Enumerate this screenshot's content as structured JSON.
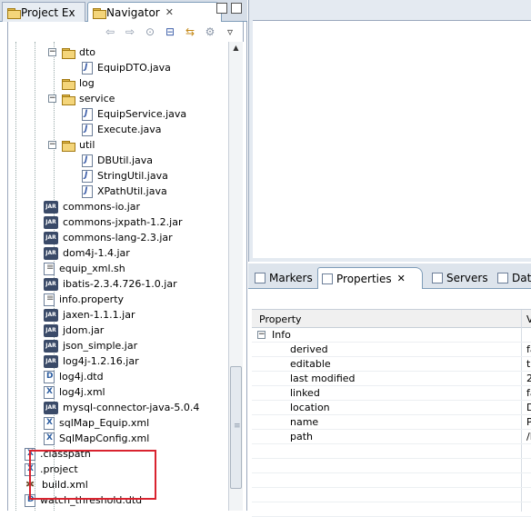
{
  "left_tabs": {
    "project_explorer": "Project Ex",
    "navigator": "Navigator",
    "close_glyph": "✕"
  },
  "tree": [
    {
      "label": "dto",
      "type": "folder",
      "expanded": true,
      "indent": 3
    },
    {
      "label": "EquipDTO.java",
      "type": "java",
      "indent": 4
    },
    {
      "label": "log",
      "type": "folder",
      "expanded": false,
      "indent": 3
    },
    {
      "label": "service",
      "type": "folder",
      "expanded": true,
      "indent": 3
    },
    {
      "label": "EquipService.java",
      "type": "java",
      "indent": 4
    },
    {
      "label": "Execute.java",
      "type": "java",
      "indent": 4
    },
    {
      "label": "util",
      "type": "folder",
      "expanded": true,
      "indent": 3
    },
    {
      "label": "DBUtil.java",
      "type": "java",
      "indent": 4
    },
    {
      "label": "StringUtil.java",
      "type": "java",
      "indent": 4
    },
    {
      "label": "XPathUtil.java",
      "type": "java",
      "indent": 4
    },
    {
      "label": "commons-io.jar",
      "type": "jar",
      "indent": 2
    },
    {
      "label": "commons-jxpath-1.2.jar",
      "type": "jar",
      "indent": 2
    },
    {
      "label": "commons-lang-2.3.jar",
      "type": "jar",
      "indent": 2
    },
    {
      "label": "dom4j-1.4.jar",
      "type": "jar",
      "indent": 2
    },
    {
      "label": "equip_xml.sh",
      "type": "text",
      "indent": 2
    },
    {
      "label": "ibatis-2.3.4.726-1.0.jar",
      "type": "jar",
      "indent": 2
    },
    {
      "label": "info.property",
      "type": "text",
      "indent": 2
    },
    {
      "label": "jaxen-1.1.1.jar",
      "type": "jar",
      "indent": 2
    },
    {
      "label": "jdom.jar",
      "type": "jar",
      "indent": 2
    },
    {
      "label": "json_simple.jar",
      "type": "jar",
      "indent": 2
    },
    {
      "label": "log4j-1.2.16.jar",
      "type": "jar",
      "indent": 2
    },
    {
      "label": "log4j.dtd",
      "type": "dtd",
      "indent": 2
    },
    {
      "label": "log4j.xml",
      "type": "xml",
      "indent": 2
    },
    {
      "label": "mysql-connector-java-5.0.4",
      "type": "jar",
      "indent": 2
    },
    {
      "label": "sqlMap_Equip.xml",
      "type": "xml",
      "indent": 2
    },
    {
      "label": "SqlMapConfig.xml",
      "type": "xml",
      "indent": 2
    },
    {
      "label": ".classpath",
      "type": "xml",
      "indent": 1
    },
    {
      "label": ".project",
      "type": "xml",
      "indent": 1
    },
    {
      "label": "build.xml",
      "type": "ant",
      "indent": 1
    },
    {
      "label": "watch_threshold.dtd",
      "type": "dtd",
      "indent": 1
    }
  ],
  "props_tabs": {
    "markers": "Markers",
    "properties": "Properties",
    "servers": "Servers",
    "data": "Dat",
    "close_glyph": "✕"
  },
  "props_table": {
    "header_property": "Property",
    "header_value": "V",
    "group": "Info",
    "rows": [
      {
        "name": "derived",
        "value": "fa"
      },
      {
        "name": "editable",
        "value": "tr"
      },
      {
        "name": "last modified",
        "value": "20"
      },
      {
        "name": "linked",
        "value": "fa"
      },
      {
        "name": "location",
        "value": "D"
      },
      {
        "name": "name",
        "value": "Pr"
      },
      {
        "name": "path",
        "value": "/P"
      }
    ]
  },
  "colors": {
    "highlight_box": "#d9232f",
    "tab_border": "#7f9db9"
  }
}
